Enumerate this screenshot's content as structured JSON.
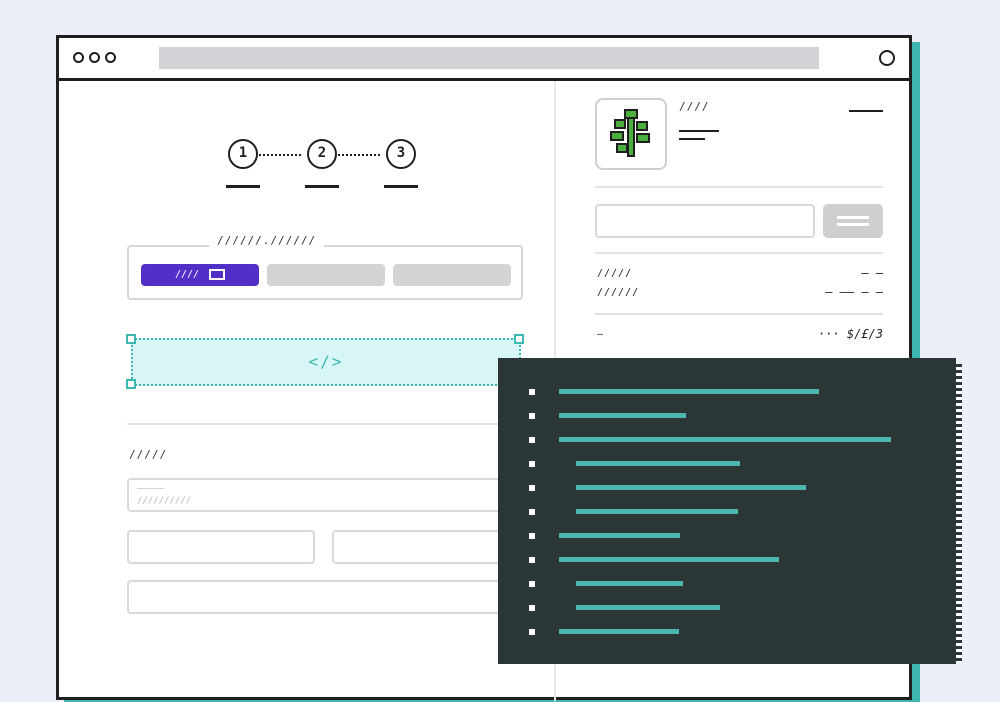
{
  "window": {
    "controls_icon": "traffic-dots-icon",
    "close_icon": "circle-icon",
    "address_text": ""
  },
  "stepper": {
    "steps": [
      "1",
      "2",
      "3"
    ]
  },
  "tabs": {
    "legend": "//////.//////",
    "items": [
      {
        "label": "////",
        "icon": "card-icon",
        "active": true
      },
      {
        "label": "",
        "active": false
      },
      {
        "label": "",
        "active": false
      }
    ]
  },
  "embed": {
    "label": "</>"
  },
  "form": {
    "section_label": "/////",
    "select_placeholder": "—————",
    "select_sub_placeholder": "//////////",
    "fields": [
      "",
      "",
      ""
    ]
  },
  "product": {
    "image_icon": "plant-icon",
    "title": "////",
    "price": ""
  },
  "coupon": {
    "input_value": "",
    "button_icon": "menu-icon"
  },
  "summary": {
    "rows": [
      {
        "label": "/////",
        "value": "— —"
      },
      {
        "label": "//////",
        "value": "— —— — —"
      }
    ],
    "total": {
      "label": "—",
      "value": "··· $/£/3"
    }
  },
  "colors": {
    "accent": "#5230c8",
    "teal": "#3fb7b1",
    "code_bg": "#2b3637",
    "plant": "#4cae3f"
  }
}
